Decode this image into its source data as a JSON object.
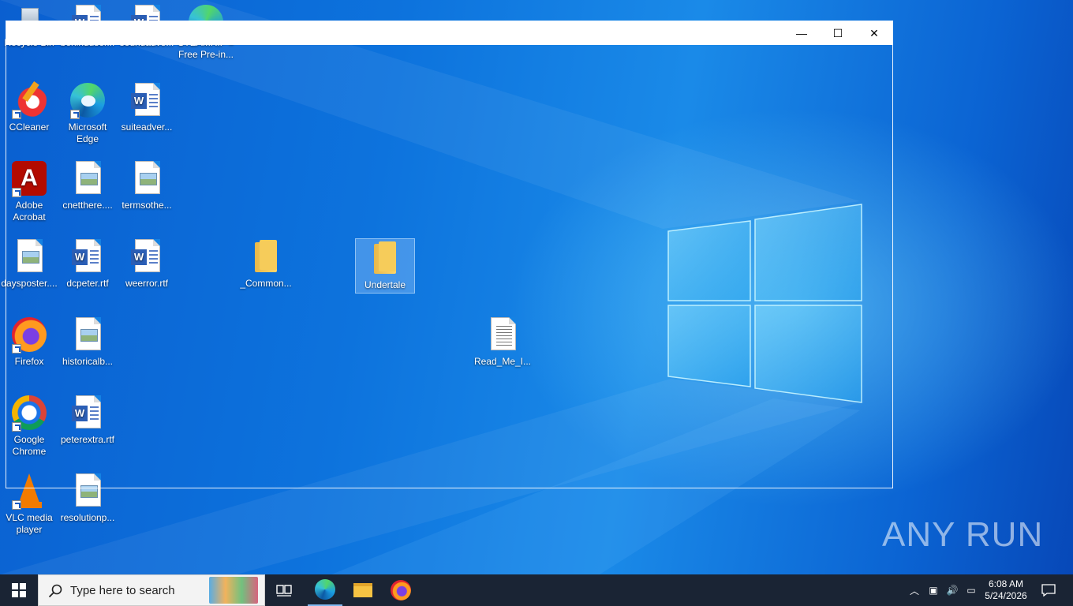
{
  "desktop": {
    "icons": [
      {
        "label": "Recycle Bin",
        "icon": "recycle-bin-icon"
      },
      {
        "label": "behinduser...",
        "icon": "word-doc-icon"
      },
      {
        "label": "soundadve...",
        "icon": "word-doc-icon"
      },
      {
        "label": "STEAMRIP » Free Pre-in...",
        "icon": "edge-shortcut-icon"
      },
      {
        "label": "CCleaner",
        "icon": "ccleaner-icon"
      },
      {
        "label": "Microsoft Edge",
        "icon": "edge-icon"
      },
      {
        "label": "suiteadver...",
        "icon": "word-doc-icon"
      },
      {
        "label": "Adobe Acrobat",
        "icon": "acrobat-icon"
      },
      {
        "label": "cnetthere....",
        "icon": "image-doc-icon"
      },
      {
        "label": "termsothe...",
        "icon": "image-doc-icon"
      },
      {
        "label": "daysposter....",
        "icon": "image-doc-icon"
      },
      {
        "label": "dcpeter.rtf",
        "icon": "word-doc-icon"
      },
      {
        "label": "weerror.rtf",
        "icon": "word-doc-icon"
      },
      {
        "label": "_Common...",
        "icon": "folder-icon"
      },
      {
        "label": "Undertale",
        "icon": "folder-icon"
      },
      {
        "label": "Firefox",
        "icon": "firefox-icon"
      },
      {
        "label": "historicalb...",
        "icon": "image-doc-icon"
      },
      {
        "label": "Read_Me_I...",
        "icon": "text-doc-icon"
      },
      {
        "label": "Google Chrome",
        "icon": "chrome-icon"
      },
      {
        "label": "peterextra.rtf",
        "icon": "word-doc-icon"
      },
      {
        "label": "VLC media player",
        "icon": "vlc-icon"
      },
      {
        "label": "resolutionp...",
        "icon": "image-doc-icon"
      }
    ],
    "selected_icon": "Undertale"
  },
  "window": {
    "controls": {
      "minimize": "—",
      "maximize": "☐",
      "close": "✕"
    }
  },
  "taskbar": {
    "search_placeholder": "Type here to search",
    "time": "6:08 AM",
    "date": "5/24/2026"
  },
  "watermark": "ANY RUN",
  "colors": {
    "taskbar": "#1a2434",
    "desktop": "#0d73dd",
    "selection": "#aad2ff"
  }
}
